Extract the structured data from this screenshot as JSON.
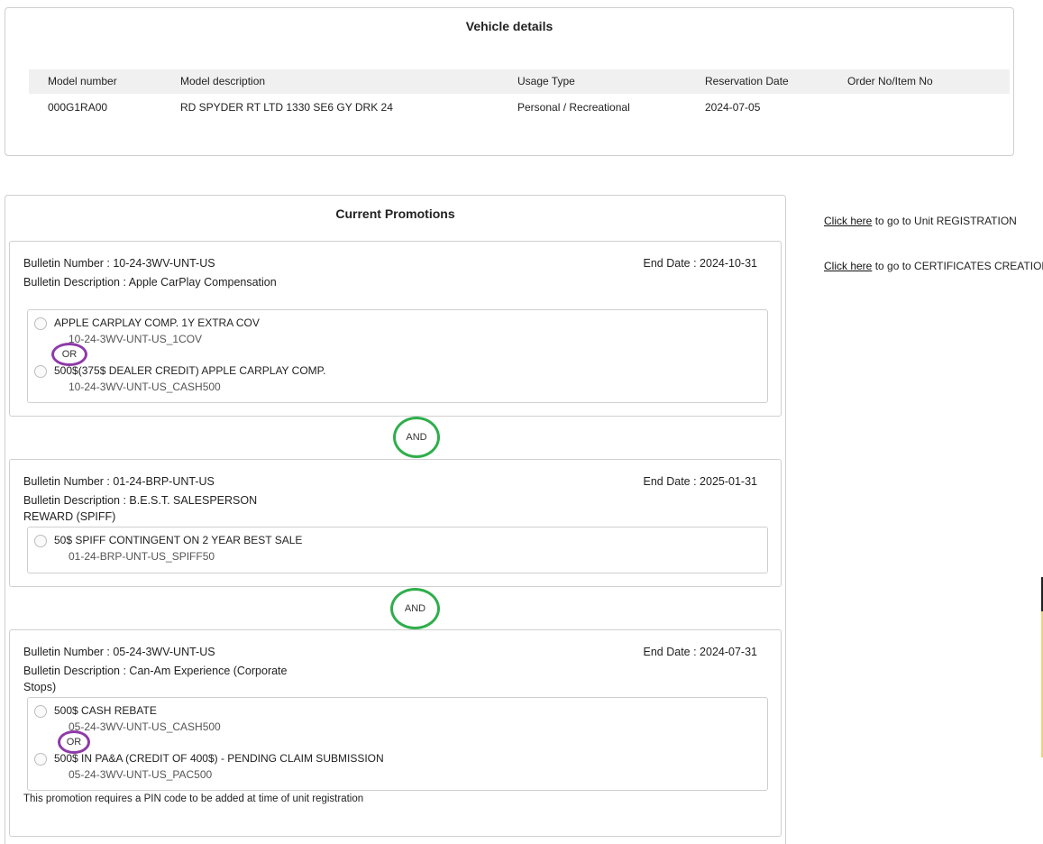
{
  "vehicle": {
    "title": "Vehicle details",
    "columns": [
      "Model number",
      "Model description",
      "Usage Type",
      "Reservation Date",
      "Order No/Item No"
    ],
    "row": [
      "000G1RA00",
      "RD SPYDER RT LTD 1330 SE6 GY DRK 24",
      "Personal / Recreational",
      "2024-07-05",
      ""
    ]
  },
  "promotions": {
    "title": "Current Promotions",
    "and_label": "AND",
    "or_label": "OR",
    "bulletins": [
      {
        "number": "Bulletin Number : 10-24-3WV-UNT-US",
        "description": "Bulletin Description : Apple CarPlay Compensation",
        "end_date": "End Date : 2024-10-31",
        "options": [
          {
            "label": "APPLE CARPLAY COMP. 1Y EXTRA COV",
            "code": "10-24-3WV-UNT-US_1COV"
          },
          {
            "label": "500$(375$ DEALER CREDIT) APPLE CARPLAY COMP.",
            "code": "10-24-3WV-UNT-US_CASH500"
          }
        ]
      },
      {
        "number": "Bulletin Number : 01-24-BRP-UNT-US",
        "description": "Bulletin Description : B.E.S.T. SALESPERSON REWARD (SPIFF)",
        "end_date": "End Date : 2025-01-31",
        "options": [
          {
            "label": "50$ SPIFF CONTINGENT ON 2 YEAR BEST SALE",
            "code": "01-24-BRP-UNT-US_SPIFF50"
          }
        ]
      },
      {
        "number": "Bulletin Number : 05-24-3WV-UNT-US",
        "description": "Bulletin Description : Can-Am Experience (Corporate Stops)",
        "end_date": "End Date : 2024-07-31",
        "options": [
          {
            "label": "500$ CASH REBATE",
            "code": "05-24-3WV-UNT-US_CASH500"
          },
          {
            "label": "500$ IN PA&A (CREDIT OF 400$) - PENDING CLAIM SUBMISSION",
            "code": "05-24-3WV-UNT-US_PAC500"
          }
        ],
        "note": "This promotion requires a PIN code to be added at time of unit registration"
      }
    ]
  },
  "side_links": [
    {
      "link_text": "Click here",
      "rest": " to go to Unit REGISTRATION"
    },
    {
      "link_text": "Click here",
      "rest": " to go to CERTIFICATES CREATION"
    }
  ],
  "colors": {
    "or_circle": "#8e3aa8",
    "and_circle": "#2fae4b",
    "header_bg": "#f0f0f0",
    "border": "#cfcfcf"
  }
}
